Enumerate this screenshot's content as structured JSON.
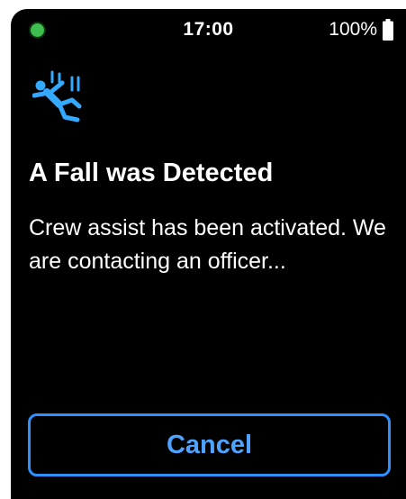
{
  "status_bar": {
    "time": "17:00",
    "battery_text": "100%",
    "battery_level": 1.0,
    "indicator_icon": "green-status-dot",
    "battery_icon": "battery-full-icon"
  },
  "alert": {
    "icon": "person-falling-icon",
    "title": "A Fall was Detected",
    "message": "Crew assist has been activated. We are contacting an officer..."
  },
  "actions": {
    "cancel_label": "Cancel"
  },
  "colors": {
    "background": "#000000",
    "text": "#ffffff",
    "accent": "#2e8fff",
    "icon": "#33aaff",
    "status_dot": "#3fbf4f"
  }
}
